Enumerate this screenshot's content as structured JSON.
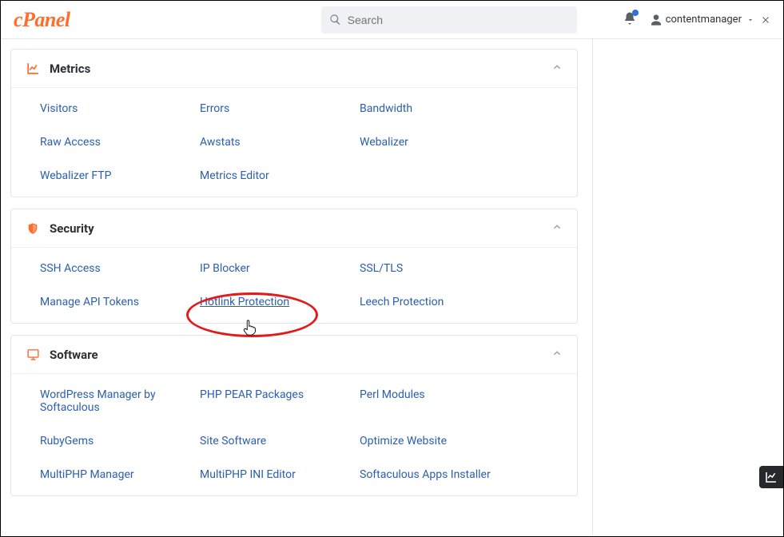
{
  "header": {
    "logo": "cPanel",
    "search_placeholder": "Search",
    "username": "contentmanager"
  },
  "panels": {
    "metrics": {
      "title": "Metrics",
      "items": {
        "0": "Visitors",
        "1": "Errors",
        "2": "Bandwidth",
        "3": "Raw Access",
        "4": "Awstats",
        "5": "Webalizer",
        "6": "Webalizer FTP",
        "7": "Metrics Editor"
      }
    },
    "security": {
      "title": "Security",
      "items": {
        "0": "SSH Access",
        "1": "IP Blocker",
        "2": "SSL/TLS",
        "3": "Manage API Tokens",
        "4": "Hotlink Protection",
        "5": "Leech Protection"
      }
    },
    "software": {
      "title": "Software",
      "items": {
        "0": "WordPress Manager by Softaculous",
        "1": "PHP PEAR Packages",
        "2": "Perl Modules",
        "3": "RubyGems",
        "4": "Site Software",
        "5": "Optimize Website",
        "6": "MultiPHP Manager",
        "7": "MultiPHP INI Editor",
        "8": "Softaculous Apps Installer"
      }
    }
  }
}
